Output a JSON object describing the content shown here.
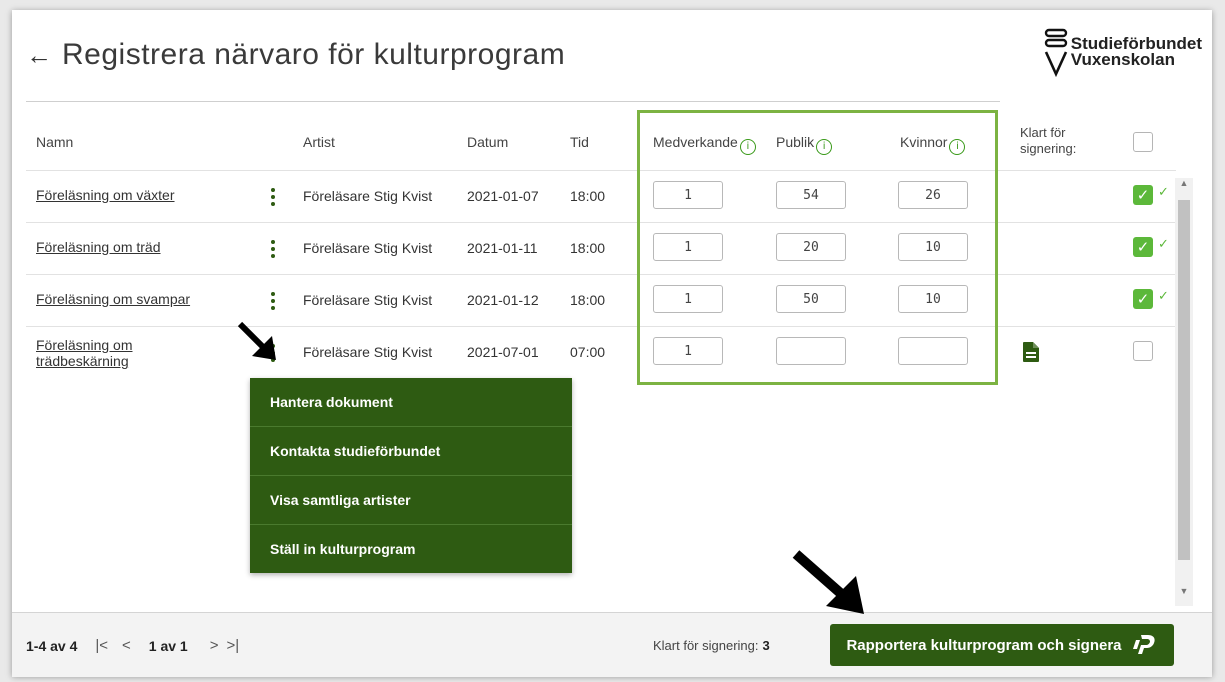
{
  "header": {
    "title": "Registrera närvaro för kulturprogram",
    "back_icon": "arrow-left-icon"
  },
  "logo": {
    "line1": "Studieförbundet",
    "line2": "Vuxenskolan"
  },
  "columns": {
    "name": "Namn",
    "artist": "Artist",
    "date": "Datum",
    "time": "Tid",
    "performers": "Medverkande",
    "audience": "Publik",
    "women": "Kvinnor",
    "ready": "Klart för signering:"
  },
  "rows": [
    {
      "name": "Föreläsning om växter",
      "artist": "Föreläsare Stig Kvist",
      "date": "2021-01-07",
      "time": "18:00",
      "performers": "1",
      "audience": "54",
      "women": "26",
      "checked": true
    },
    {
      "name": "Föreläsning om träd",
      "artist": "Föreläsare Stig Kvist",
      "date": "2021-01-11",
      "time": "18:00",
      "performers": "1",
      "audience": "20",
      "women": "10",
      "checked": true
    },
    {
      "name": "Föreläsning om svampar",
      "artist": "Föreläsare Stig Kvist",
      "date": "2021-01-12",
      "time": "18:00",
      "performers": "1",
      "audience": "50",
      "women": "10",
      "checked": true
    },
    {
      "name": "Föreläsning om trädbeskärning",
      "name_line1": "Föreläsning om",
      "name_line2": "trädbeskärning",
      "artist": "Föreläsare Stig Kvist",
      "date": "2021-07-01",
      "time": "07:00",
      "performers": "1",
      "audience": "",
      "women": "",
      "checked": false
    }
  ],
  "menu": {
    "items": [
      "Hantera dokument",
      "Kontakta studieförbundet",
      "Visa samtliga artister",
      "Ställ in kulturprogram"
    ]
  },
  "footer": {
    "range": "1-4 av 4",
    "page": "1 av 1",
    "ready_label": "Klart för signering:",
    "ready_count": "3",
    "report_button": "Rapportera kulturprogram och signera"
  },
  "colors": {
    "brand_green": "#2e5b12",
    "check_green": "#5cb83a",
    "highlight_border": "#7cb342"
  }
}
